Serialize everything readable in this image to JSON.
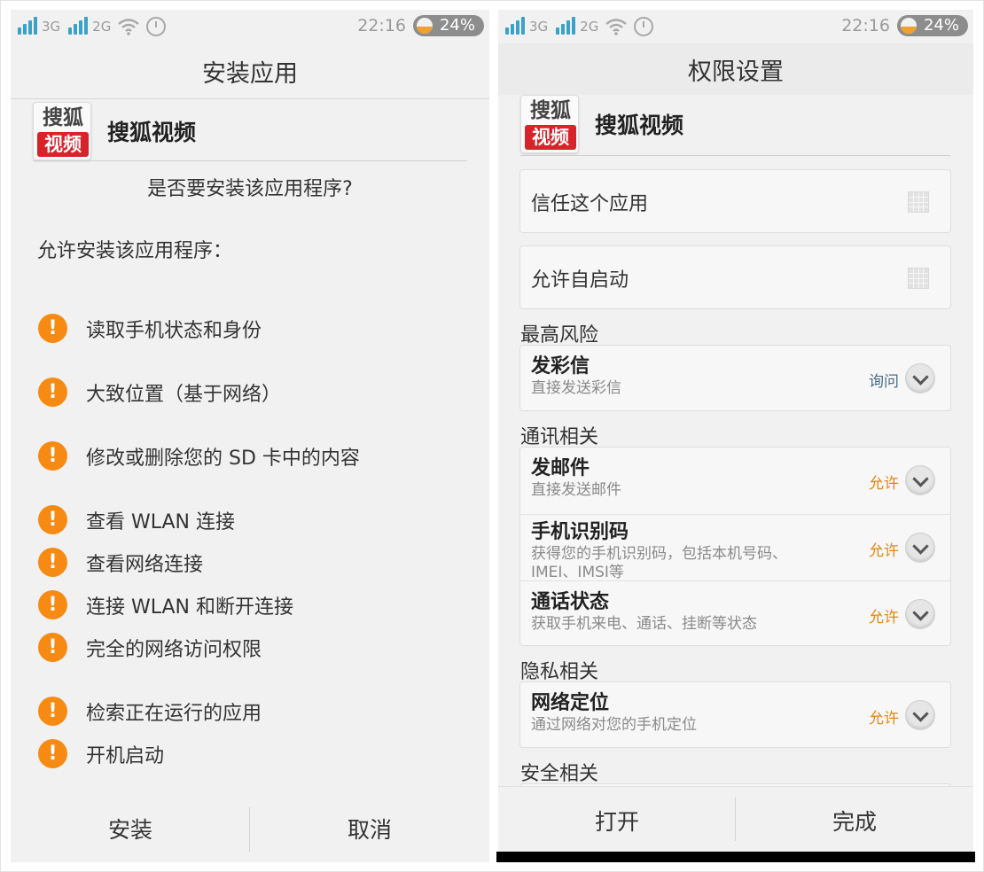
{
  "status_bar": {
    "network_1": "3G",
    "network_2": "2G",
    "time": "22:16",
    "battery": "24%"
  },
  "colors": {
    "warning_orange": "#f78a12",
    "allow_orange": "#e8850c",
    "ask_blue": "#4a6a8a",
    "app_red": "#d8232a"
  },
  "install_screen": {
    "title": "安装应用",
    "app_icon_top": "搜狐",
    "app_icon_bottom": "视频",
    "app_name": "搜狐视频",
    "question": "是否要安装该应用程序?",
    "allow_heading": "允许安装该应用程序：",
    "warning_icon": "warning-icon",
    "permissions": [
      "读取手机状态和身份",
      "大致位置（基于网络）",
      "修改或删除您的 SD 卡中的内容",
      "查看 WLAN 连接",
      "查看网络连接",
      "连接 WLAN 和断开连接",
      "完全的网络访问权限",
      "检索正在运行的应用",
      "开机启动"
    ],
    "install_button": "安装",
    "cancel_button": "取消"
  },
  "permission_screen": {
    "title": "权限设置",
    "app_icon_top": "搜狐",
    "app_icon_bottom": "视频",
    "app_name": "搜狐视频",
    "trust_label": "信任这个应用",
    "autostart_label": "允许自启动",
    "sections": [
      {
        "label": "最高风险",
        "items": [
          {
            "title": "发彩信",
            "desc": "直接发送彩信",
            "status": "询问"
          }
        ]
      },
      {
        "label": "通讯相关",
        "items": [
          {
            "title": "发邮件",
            "desc": "直接发送邮件",
            "status": "允许"
          },
          {
            "title": "手机识别码",
            "desc": "获得您的手机识别码，包括本机号码、IMEI、IMSI等",
            "status": "允许"
          },
          {
            "title": "通话状态",
            "desc": "获取手机来电、通话、挂断等状态",
            "status": "允许"
          }
        ]
      },
      {
        "label": "隐私相关",
        "items": [
          {
            "title": "网络定位",
            "desc": "通过网络对您的手机定位",
            "status": "允许"
          }
        ]
      },
      {
        "label": "安全相关",
        "items": []
      }
    ],
    "open_button": "打开",
    "done_button": "完成"
  }
}
